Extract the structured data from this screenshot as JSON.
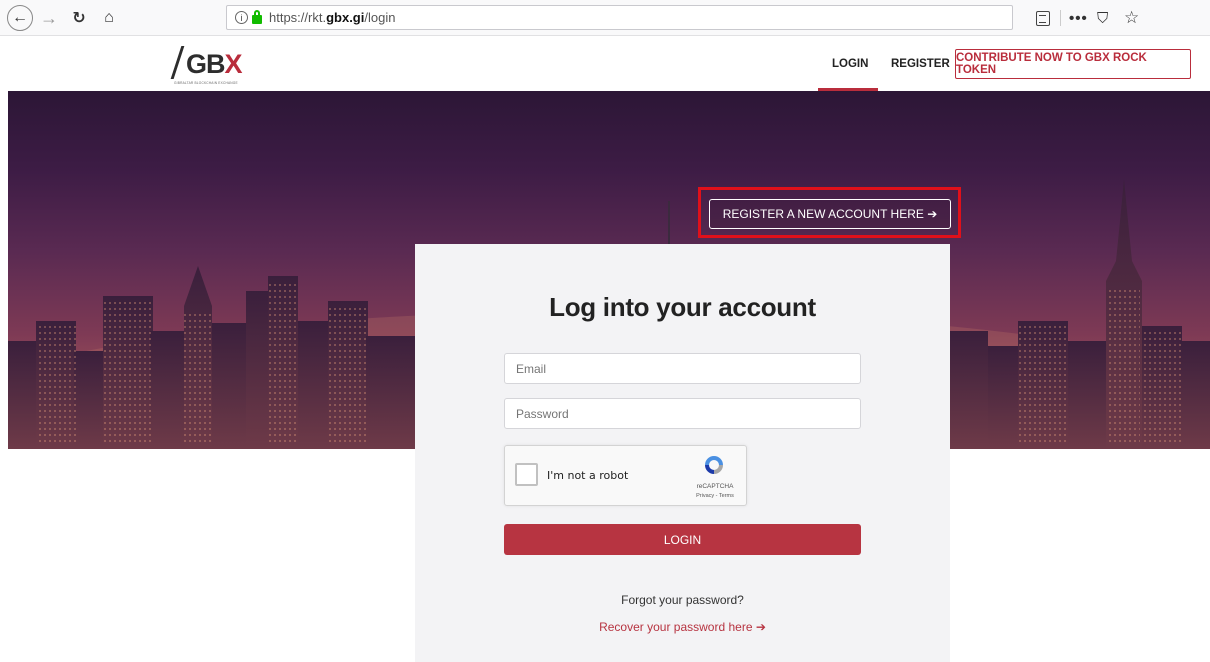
{
  "browser": {
    "url_prefix": "https://rkt.",
    "url_host": "gbx.gi",
    "url_path": "/login",
    "icons": {
      "back": "←",
      "forward": "→",
      "reload": "↻",
      "home": "⌂",
      "more": "•••",
      "pocket": "⛉",
      "star": "☆",
      "info": "i"
    }
  },
  "header": {
    "logo_main": "GB",
    "logo_x": "X",
    "logo_sub": "GIBRALTAR BLOCKCHAIN EXCHANGE",
    "nav": {
      "login": "LOGIN",
      "register": "REGISTER",
      "contribute": "CONTRIBUTE NOW TO GBX ROCK TOKEN"
    },
    "accent": "#b92d3c"
  },
  "hero": {
    "register_button": "REGISTER A NEW ACCOUNT HERE ➔",
    "highlight_color": "#e0101a"
  },
  "login_card": {
    "title": "Log into your account",
    "email_placeholder": "Email",
    "password_placeholder": "Password",
    "recaptcha": {
      "label": "I'm not a robot",
      "brand": "reCAPTCHA",
      "links": "Privacy - Terms"
    },
    "login_button": "LOGIN",
    "forgot_text": "Forgot your password?",
    "recover_link": "Recover your password here ➔"
  }
}
